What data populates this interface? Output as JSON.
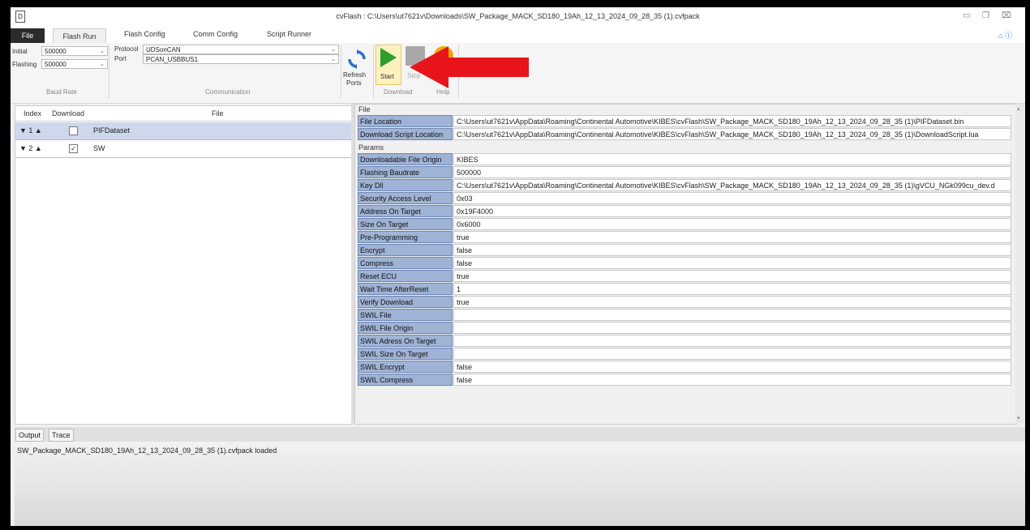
{
  "window": {
    "title": "cvFlash : C:\\Users\\ut7621v\\Downloads\\SW_Package_MACK_SD180_19Ah_12_13_2024_09_28_35 (1).cvfpack",
    "app_icon": "app-icon",
    "help_icons": "⌂ ⓘ"
  },
  "tabs": {
    "file": "File",
    "flash_run": "Flash Run",
    "flash_config": "Flash Config",
    "comm_config": "Comm Config",
    "script_runner": "Script Runner"
  },
  "ribbon": {
    "initial_label": "Initial",
    "initial_value": "500000",
    "flashing_label": "Flashing",
    "flashing_value": "500000",
    "baud_rate_group": "Baud Rate",
    "protocol_label": "Protocol",
    "protocol_value": "UDSonCAN",
    "port_label": "Port",
    "port_value": "PCAN_USBBUS1",
    "communication_group": "Communication",
    "refresh_label": "Refresh",
    "ports_label": "Ports",
    "start_label": "Start",
    "stop_label": "Stop",
    "download_group": "Download",
    "help_group": "Help"
  },
  "file_table": {
    "headers": {
      "index": "Index",
      "download": "Download",
      "file": "File"
    },
    "rows": [
      {
        "index": "▼ 1 ▲",
        "checked": "",
        "file": "PIFDataset"
      },
      {
        "index": "▼ 2 ▲",
        "checked": "✓",
        "file": "SW"
      }
    ]
  },
  "details": {
    "file_section": "File",
    "file_props": [
      {
        "name": "File Location",
        "value": "C:\\Users\\ut7621v\\AppData\\Roaming\\Continental Automotive\\KIBES\\cvFlash\\SW_Package_MACK_SD180_19Ah_12_13_2024_09_28_35 (1)\\PIFDataset.bin"
      },
      {
        "name": "Download Script Location",
        "value": "C:\\Users\\ut7621v\\AppData\\Roaming\\Continental Automotive\\KIBES\\cvFlash\\SW_Package_MACK_SD180_19Ah_12_13_2024_09_28_35 (1)\\DownloadScript.lua"
      }
    ],
    "params_section": "Params",
    "params": [
      {
        "name": "Downloadable File Origin",
        "value": "KIBES"
      },
      {
        "name": "Flashing Baudrate",
        "value": "500000"
      },
      {
        "name": "Key Dll",
        "value": "C:\\Users\\ut7621v\\AppData\\Roaming\\Continental Automotive\\KIBES\\cvFlash\\SW_Package_MACK_SD180_19Ah_12_13_2024_09_28_35 (1)\\gVCU_NGk099cu_dev.d"
      },
      {
        "name": "Security Access Level",
        "value": "0x03"
      },
      {
        "name": "Address On Target",
        "value": "0x19F4000"
      },
      {
        "name": "Size On Target",
        "value": "0x6000"
      },
      {
        "name": "Pre-Programming",
        "value": "true"
      },
      {
        "name": "Encrypt",
        "value": "false"
      },
      {
        "name": "Compress",
        "value": "false"
      },
      {
        "name": "Reset ECU",
        "value": "true"
      },
      {
        "name": "Wait Time AfterReset",
        "value": "1"
      },
      {
        "name": "Verify Download",
        "value": "true"
      },
      {
        "name": "SWIL File",
        "value": ""
      },
      {
        "name": "SWIL File Origin",
        "value": ""
      },
      {
        "name": "SWIL Adress On Target",
        "value": ""
      },
      {
        "name": "SWIL Size On Target",
        "value": ""
      },
      {
        "name": "SWIL Encrypt",
        "value": "false"
      },
      {
        "name": "SWIL Compress",
        "value": "false"
      }
    ]
  },
  "output": {
    "tab_output": "Output",
    "tab_trace": "Trace",
    "message": "SW_Package_MACK_SD180_19Ah_12_13_2024_09_28_35 (1).cvfpack loaded"
  },
  "colors": {
    "start_green": "#2e9e2e",
    "annotation_red": "#e8141c",
    "property_name_bg": "#9fb3d6"
  }
}
